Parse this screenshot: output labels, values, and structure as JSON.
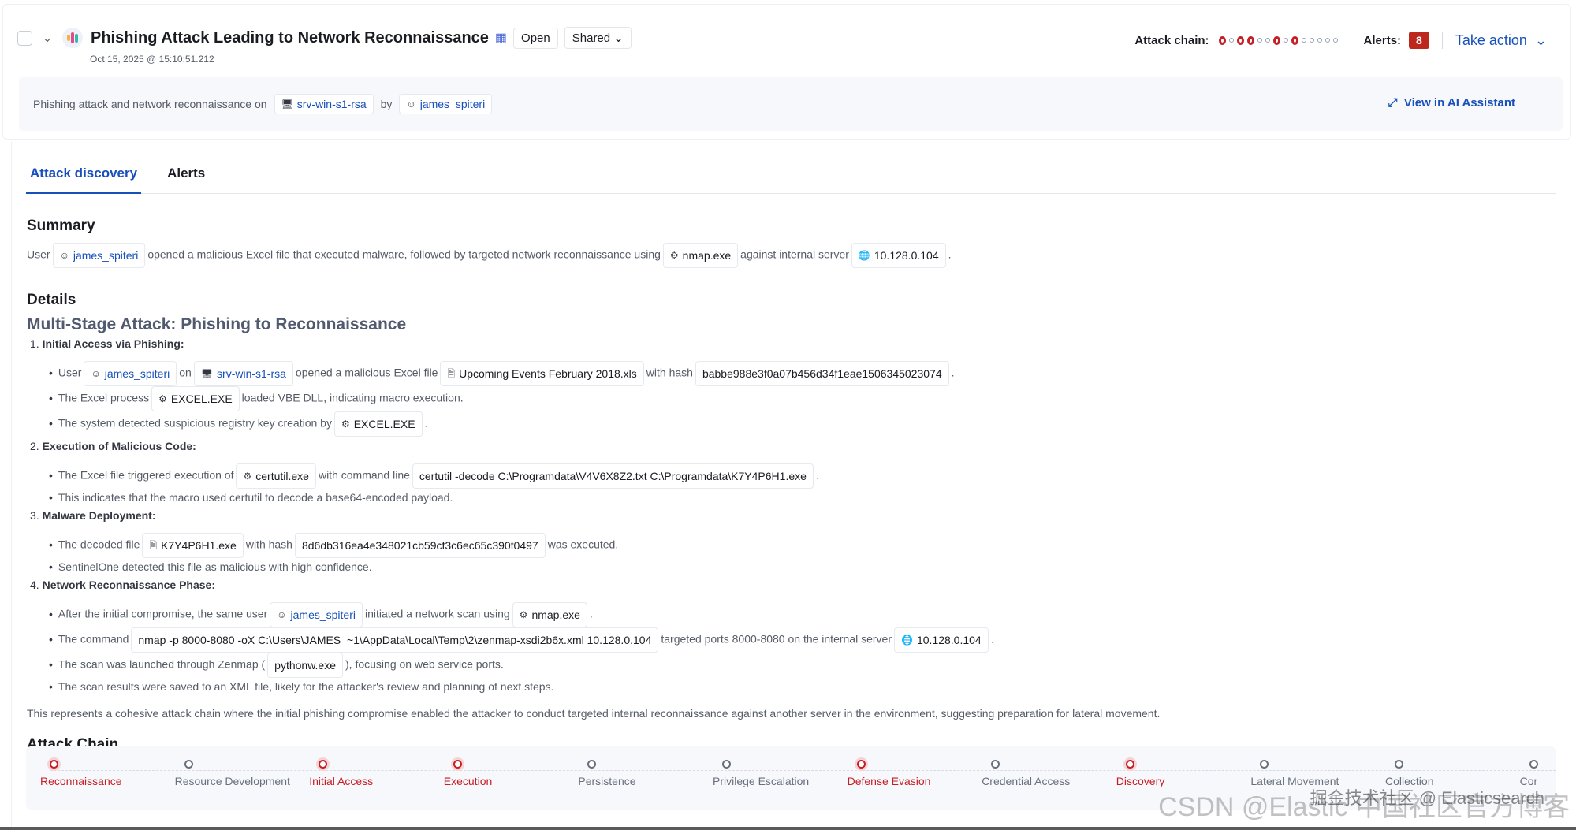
{
  "header": {
    "title": "Phishing Attack Leading to Network Reconnaissance",
    "status": "Open",
    "visibility": "Shared",
    "timestamp": "Oct 15, 2025 @ 15:10:51.212",
    "attack_chain_label": "Attack chain:",
    "attack_chain_detected": [
      true,
      false,
      true,
      true,
      false,
      false,
      true,
      false,
      true,
      false,
      false,
      false,
      false,
      false
    ],
    "alerts_label": "Alerts:",
    "alerts_count": "8",
    "take_action": "Take action"
  },
  "info": {
    "prefix": "Phishing attack and network reconnaissance on",
    "host": "srv-win-s1-rsa",
    "by": "by",
    "user": "james_spiteri",
    "ai_link": "View in AI Assistant"
  },
  "tabs": [
    "Attack discovery",
    "Alerts"
  ],
  "summary": {
    "heading": "Summary",
    "segments": [
      {
        "t": "User"
      },
      {
        "chip": "james_spiteri",
        "icon": "user",
        "link": true
      },
      {
        "t": "opened a malicious Excel file that executed malware, followed by targeted network reconnaissance using"
      },
      {
        "chip": "nmap.exe",
        "icon": "gear"
      },
      {
        "t": "against internal server"
      },
      {
        "chip": "10.128.0.104",
        "icon": "globe"
      },
      {
        "t": "."
      }
    ]
  },
  "details": {
    "heading": "Details",
    "subheading": "Multi-Stage Attack: Phishing to Reconnaissance",
    "sections": [
      {
        "num": "1.",
        "title": "Initial Access via Phishing:",
        "bullets": [
          [
            {
              "t": "User"
            },
            {
              "chip": "james_spiteri",
              "icon": "user",
              "link": true
            },
            {
              "t": "on"
            },
            {
              "chip": "srv-win-s1-rsa",
              "icon": "host",
              "link": true
            },
            {
              "t": "opened a malicious Excel file"
            },
            {
              "chip": "Upcoming Events February 2018.xls",
              "icon": "file"
            },
            {
              "t": "with hash"
            },
            {
              "chip": "babbe988e3f0a07b456d34f1eae1506345023074"
            },
            {
              "t": "."
            }
          ],
          [
            {
              "t": "The Excel process"
            },
            {
              "chip": "EXCEL.EXE",
              "icon": "gear"
            },
            {
              "t": "loaded VBE DLL, indicating macro execution."
            }
          ],
          [
            {
              "t": "The system detected suspicious registry key creation by"
            },
            {
              "chip": "EXCEL.EXE",
              "icon": "gear"
            },
            {
              "t": "."
            }
          ]
        ]
      },
      {
        "num": "2.",
        "title": "Execution of Malicious Code:",
        "bullets": [
          [
            {
              "t": "The Excel file triggered execution of"
            },
            {
              "chip": "certutil.exe",
              "icon": "gear"
            },
            {
              "t": "with command line"
            },
            {
              "chip": "certutil -decode C:\\Programdata\\V4V6X8Z2.txt C:\\Programdata\\K7Y4P6H1.exe"
            },
            {
              "t": "."
            }
          ],
          [
            {
              "t": "This indicates that the macro used certutil to decode a base64-encoded payload."
            }
          ]
        ]
      },
      {
        "num": "3.",
        "title": "Malware Deployment:",
        "bullets": [
          [
            {
              "t": "The decoded file"
            },
            {
              "chip": "K7Y4P6H1.exe",
              "icon": "file"
            },
            {
              "t": "with hash"
            },
            {
              "chip": "8d6db316ea4e348021cb59cf3c6ec65c390f0497"
            },
            {
              "t": "was executed."
            }
          ],
          [
            {
              "t": "SentinelOne detected this file as malicious with high confidence."
            }
          ]
        ]
      },
      {
        "num": "4.",
        "title": "Network Reconnaissance Phase:",
        "bullets": [
          [
            {
              "t": "After the initial compromise, the same user"
            },
            {
              "chip": "james_spiteri",
              "icon": "user",
              "link": true
            },
            {
              "t": "initiated a network scan using"
            },
            {
              "chip": "nmap.exe",
              "icon": "gear"
            },
            {
              "t": "."
            }
          ],
          [
            {
              "t": "The command"
            },
            {
              "chip": "nmap -p 8000-8080 -oX C:\\Users\\JAMES_~1\\AppData\\Local\\Temp\\2\\zenmap-xsdi2b6x.xml 10.128.0.104"
            },
            {
              "t": "targeted ports 8000-8080 on the internal server"
            },
            {
              "chip": "10.128.0.104",
              "icon": "globe"
            },
            {
              "t": "."
            }
          ],
          [
            {
              "t": "The scan was launched through Zenmap ("
            },
            {
              "chip": "pythonw.exe"
            },
            {
              "t": "), focusing on web service ports."
            }
          ],
          [
            {
              "t": "The scan results were saved to an XML file, likely for the attacker's review and planning of next steps."
            }
          ]
        ]
      }
    ],
    "conclusion": "This represents a cohesive attack chain where the initial phishing compromise enabled the attacker to conduct targeted internal reconnaissance against another server in the environment, suggesting preparation for lateral movement."
  },
  "attack_chain": {
    "heading": "Attack Chain",
    "tactics": [
      {
        "name": "Reconnaissance",
        "detected": true
      },
      {
        "name": "Resource Development",
        "detected": false
      },
      {
        "name": "Initial Access",
        "detected": true
      },
      {
        "name": "Execution",
        "detected": true
      },
      {
        "name": "Persistence",
        "detected": false
      },
      {
        "name": "Privilege Escalation",
        "detected": false
      },
      {
        "name": "Defense Evasion",
        "detected": true
      },
      {
        "name": "Credential Access",
        "detected": false
      },
      {
        "name": "Discovery",
        "detected": true
      },
      {
        "name": "Lateral Movement",
        "detected": false
      },
      {
        "name": "Collection",
        "detected": false
      },
      {
        "name": "Cor",
        "detected": false
      }
    ]
  },
  "watermark": {
    "a": "CSDN @Elastic 中国社区官方博客",
    "b": "掘金技术社区 @ Elasticsearch"
  }
}
